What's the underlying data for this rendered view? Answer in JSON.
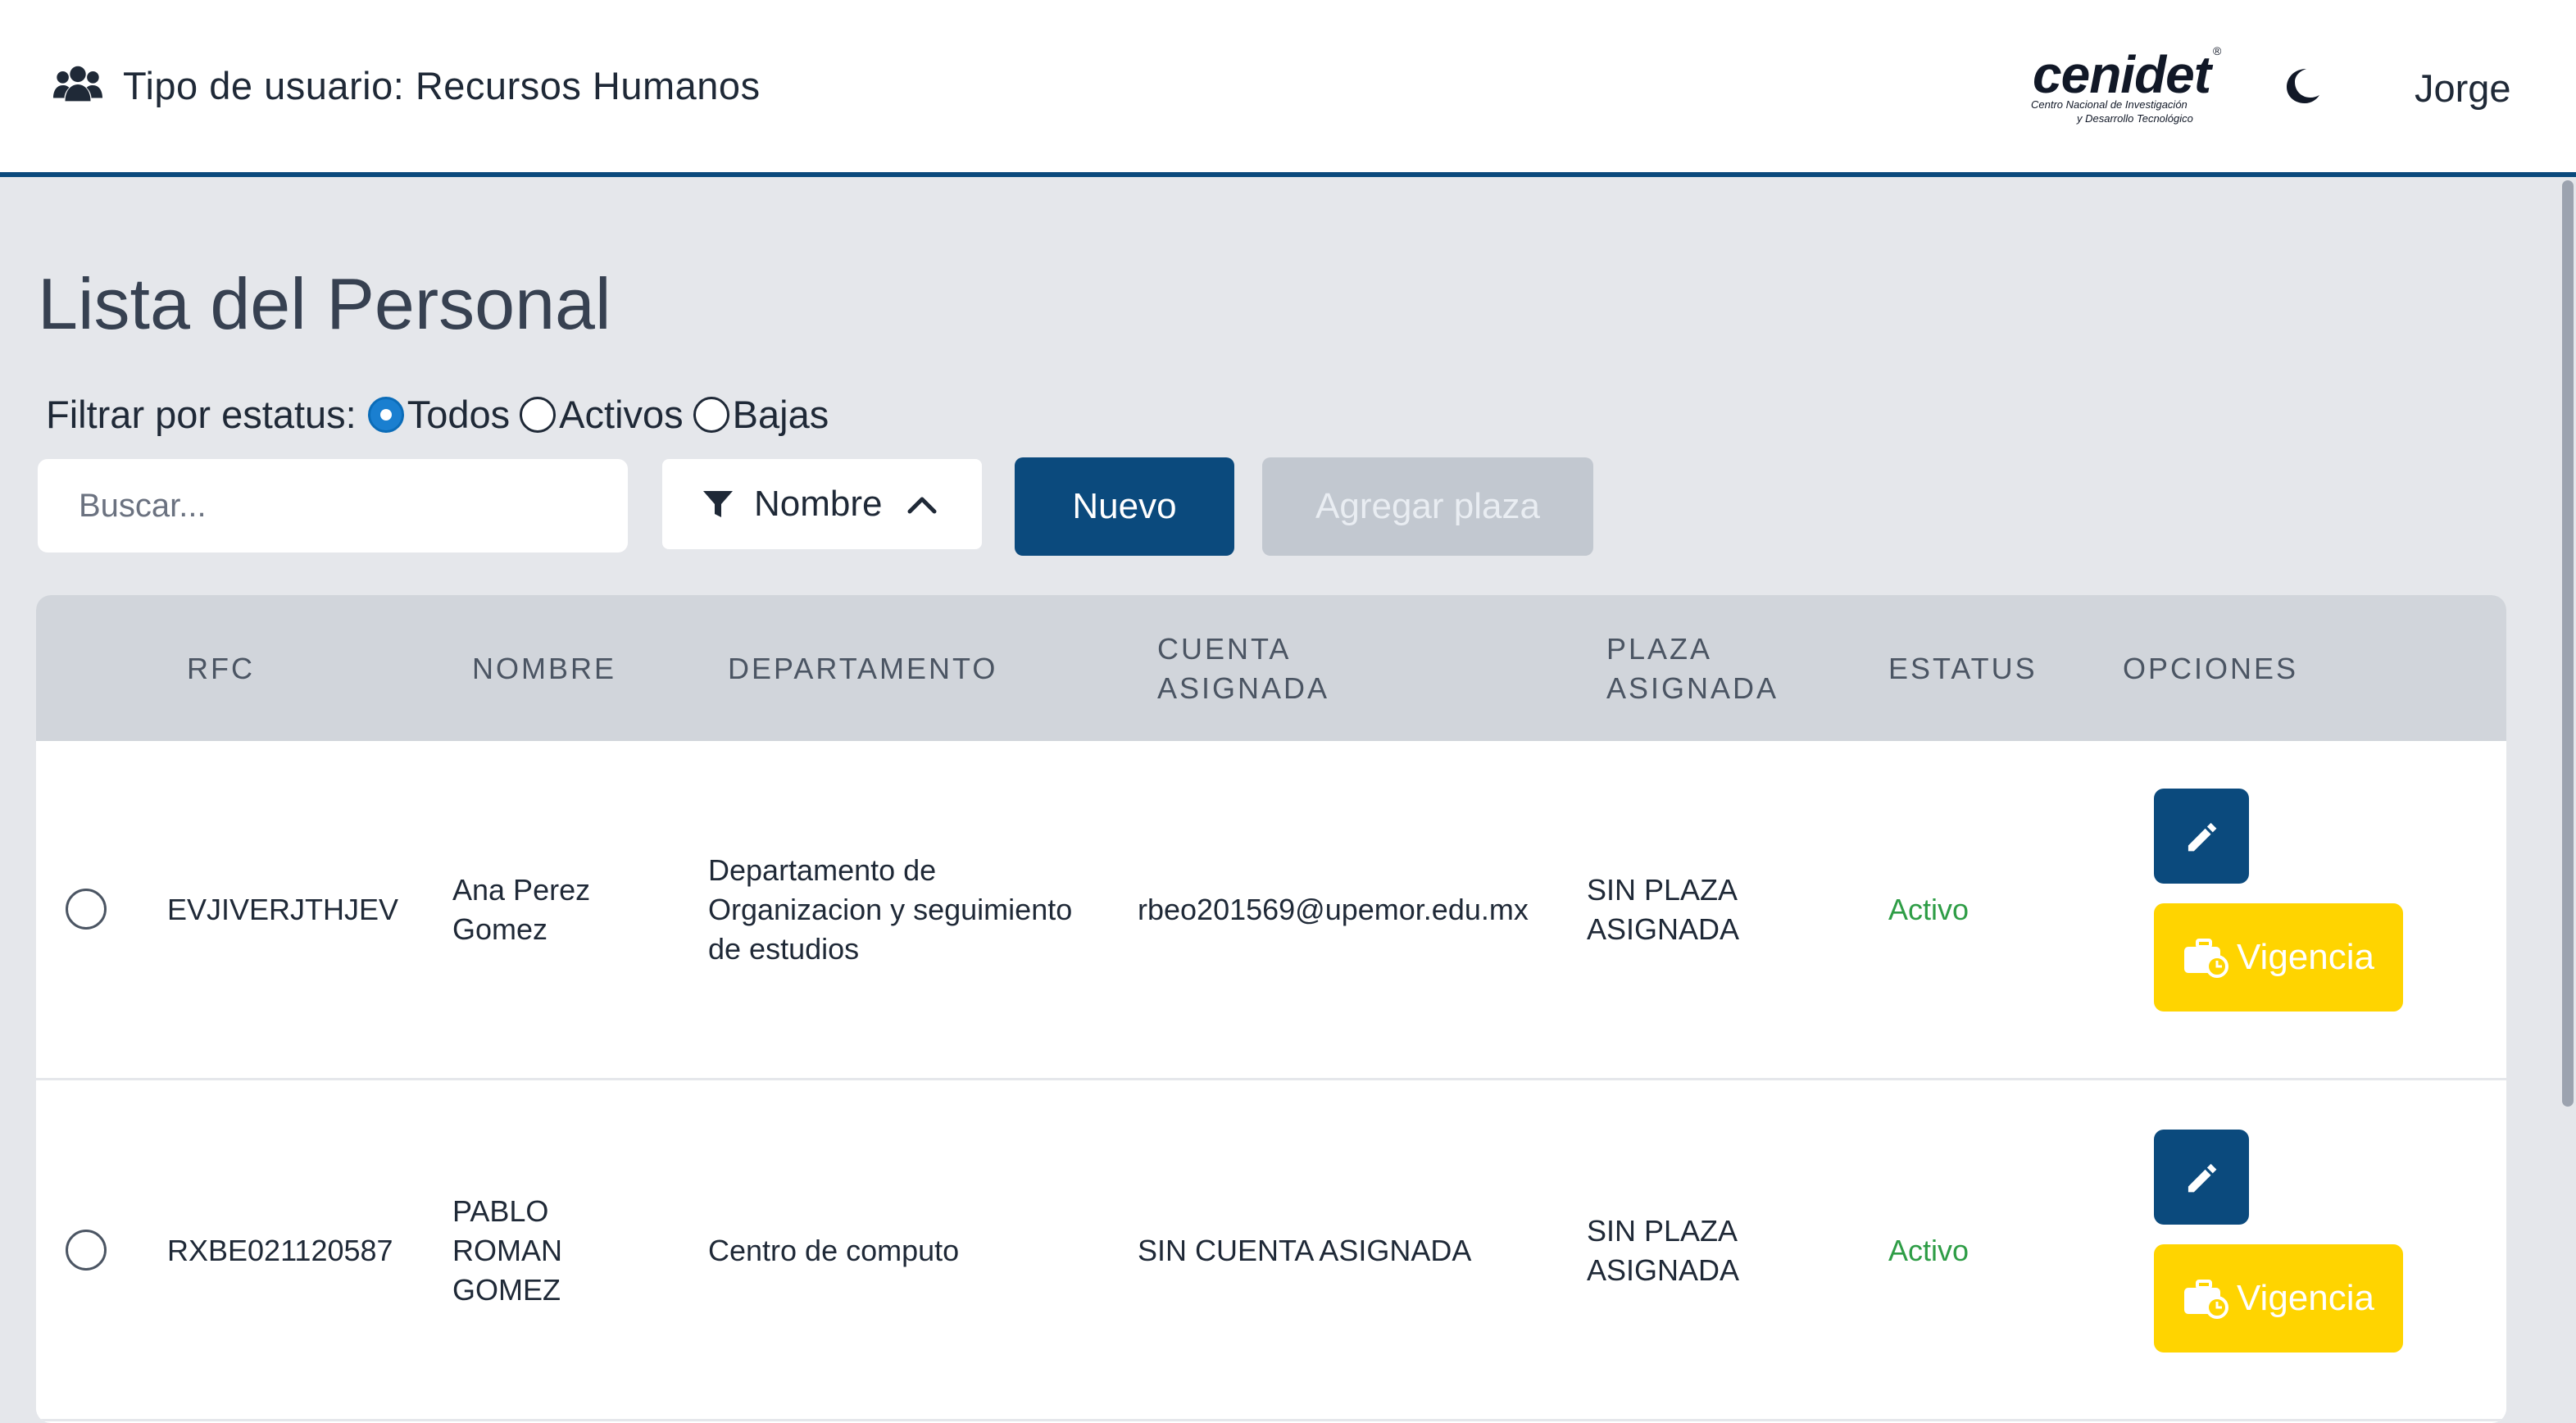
{
  "header": {
    "user_type_label": "Tipo de usuario: Recursos Humanos",
    "users_icon": "users-icon",
    "logo": {
      "word": "cenidet",
      "line1": "Centro Nacional de Investigación",
      "line2": "y Desarrollo Tecnológico",
      "reg": "®"
    },
    "theme_icon": "moon-icon",
    "username": "Jorge"
  },
  "page": {
    "title": "Lista del Personal"
  },
  "filter": {
    "label": "Filtrar por estatus:",
    "options": [
      "Todos",
      "Activos",
      "Bajas"
    ],
    "selected": "Todos"
  },
  "toolbar": {
    "search_placeholder": "Buscar...",
    "sort_label": "Nombre",
    "sort_icon": "filter-icon",
    "sort_chevron": "chevron-up-icon",
    "new_label": "Nuevo",
    "add_plaza_label": "Agregar plaza"
  },
  "table": {
    "headers": [
      "RFC",
      "NOMBRE",
      "DEPARTAMENTO",
      "CUENTA\nASIGNADA",
      "PLAZA\nASIGNADA",
      "ESTATUS",
      "OPCIONES"
    ],
    "rows": [
      {
        "rfc": "EVJIVERJTHJEV",
        "nombre": "Ana Perez\nGomez",
        "departamento": "Departamento de\nOrganizacion y seguimiento\nde estudios",
        "cuenta": "rbeo201569@upemor.edu.mx",
        "plaza": "SIN PLAZA\nASIGNADA",
        "estatus": "Activo",
        "vigencia_label": "Vigencia"
      },
      {
        "rfc": "RXBE021120587",
        "nombre": "PABLO\nROMAN\nGOMEZ",
        "departamento": "Centro de computo",
        "cuenta": "SIN CUENTA ASIGNADA",
        "plaza": "SIN PLAZA\nASIGNADA",
        "estatus": "Activo",
        "vigencia_label": "Vigencia"
      }
    ]
  },
  "colors": {
    "primary": "#0b4a7d",
    "status_active": "#2e9d46",
    "vigencia": "#ffd400",
    "background": "#e5e7eb"
  }
}
